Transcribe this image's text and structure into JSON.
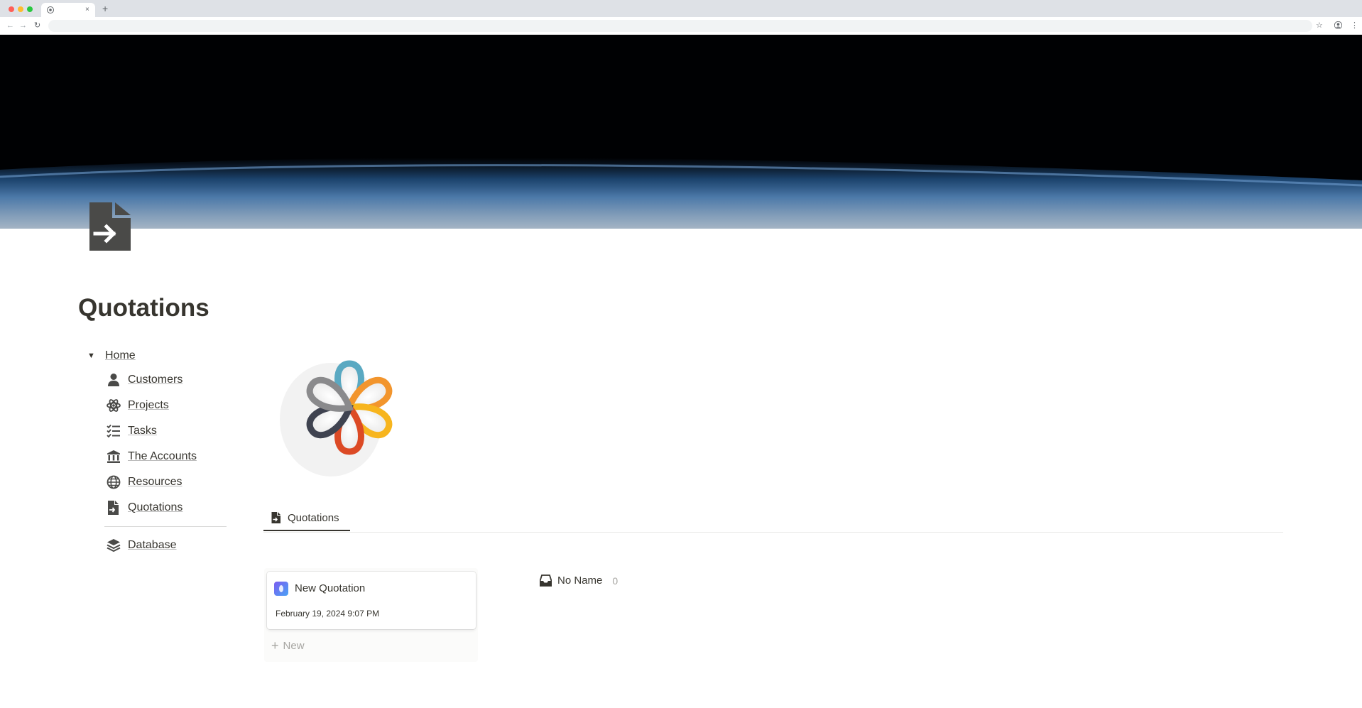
{
  "browser": {
    "new_tab_label": "+",
    "tab_close": "×"
  },
  "page": {
    "title": "Quotations",
    "icon": "document-arrow-icon"
  },
  "sidebar": {
    "home_label": "Home",
    "items": [
      {
        "label": "Customers",
        "icon": "person-icon"
      },
      {
        "label": "Projects",
        "icon": "atom-icon"
      },
      {
        "label": "Tasks",
        "icon": "checklist-icon"
      },
      {
        "label": "The Accounts",
        "icon": "bank-icon"
      },
      {
        "label": "Resources",
        "icon": "globe-icon"
      },
      {
        "label": "Quotations",
        "icon": "document-arrow-icon"
      }
    ],
    "database_label": "Database"
  },
  "view": {
    "tab_label": "Quotations"
  },
  "board": {
    "card": {
      "title": "New Quotation",
      "date": "February 19, 2024 9:07 PM"
    },
    "new_label": "New",
    "group": {
      "label": "No Name",
      "count": "0"
    }
  },
  "colors": {
    "text": "#37352f",
    "muted": "#a7a6a2",
    "icon": "#4a4a48"
  }
}
